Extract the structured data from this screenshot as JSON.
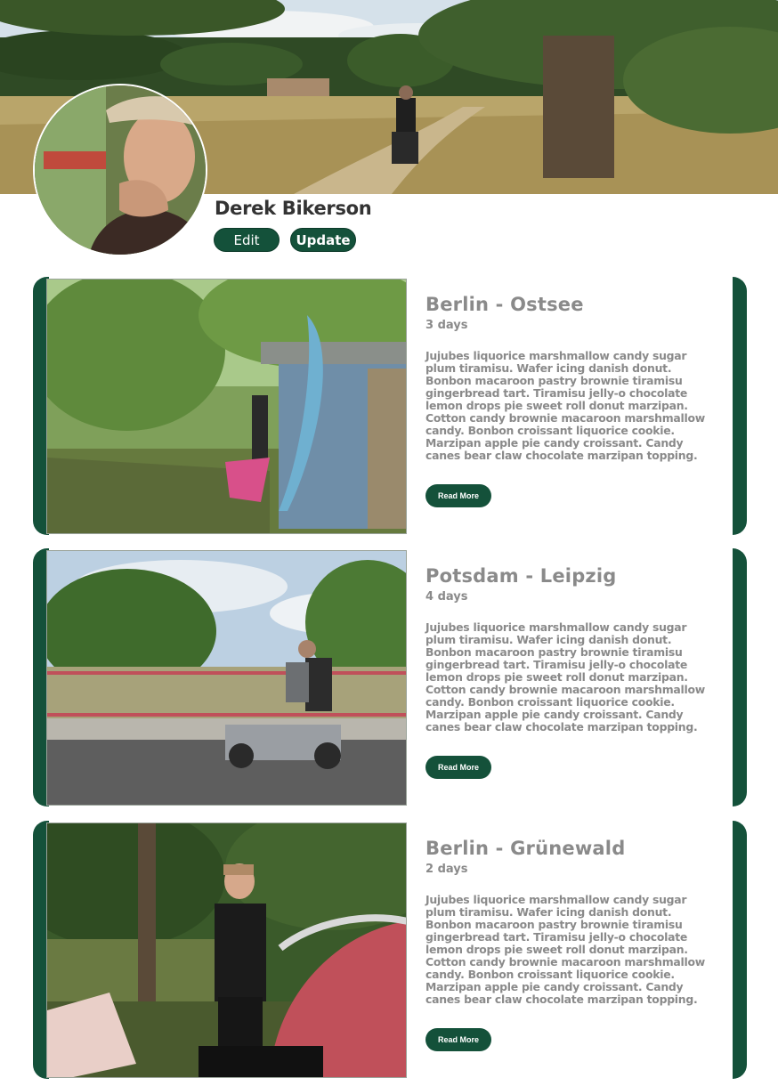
{
  "profile": {
    "name": "Derek Bikerson",
    "edit_label": "Edit",
    "update_label": "Update"
  },
  "trips": [
    {
      "title": "Berlin - Ostsee",
      "duration": "3 days",
      "description": "Jujubes liquorice marshmallow candy sugar plum tiramisu. Wafer icing danish donut. Bonbon macaroon pastry brownie tiramisu gingerbread tart. Tiramisu jelly-o chocolate lemon drops pie sweet roll donut marzipan. Cotton candy brownie macaroon marshmallow candy. Bonbon croissant liquorice cookie. Marzipan apple pie candy croissant. Candy canes bear claw chocolate marzipan topping.",
      "read_more_label": "Read More"
    },
    {
      "title": "Potsdam - Leipzig",
      "duration": "4 days",
      "description": "Jujubes liquorice marshmallow candy sugar plum tiramisu. Wafer icing danish donut. Bonbon macaroon pastry brownie tiramisu gingerbread tart. Tiramisu jelly-o chocolate lemon drops pie sweet roll donut marzipan. Cotton candy brownie macaroon marshmallow candy. Bonbon croissant liquorice cookie. Marzipan apple pie candy croissant. Candy canes bear claw chocolate marzipan topping.",
      "read_more_label": "Read More"
    },
    {
      "title": "Berlin - Grünewald",
      "duration": "2 days",
      "description": "Jujubes liquorice marshmallow candy sugar plum tiramisu. Wafer icing danish donut. Bonbon macaroon pastry brownie tiramisu gingerbread tart. Tiramisu jelly-o chocolate lemon drops pie sweet roll donut marzipan. Cotton candy brownie macaroon marshmallow candy. Bonbon croissant liquorice cookie. Marzipan apple pie candy croissant. Candy canes bear claw chocolate marzipan topping.",
      "read_more_label": "Read More"
    }
  ],
  "theme": {
    "accent": "#14513a",
    "text_muted": "#8a8a8a",
    "name_color": "#333333",
    "background": "#ffffff"
  }
}
